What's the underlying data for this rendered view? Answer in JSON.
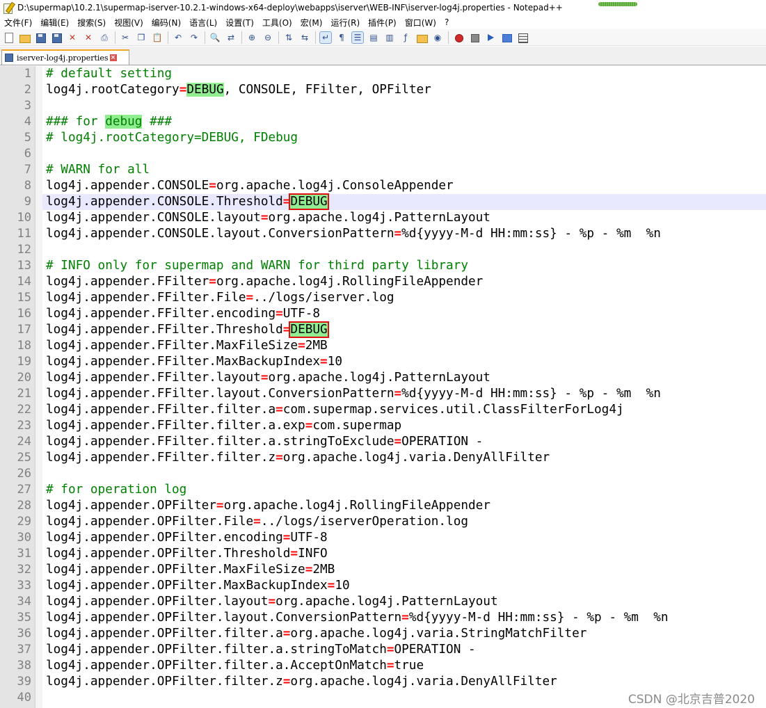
{
  "window": {
    "title": "D:\\supermap\\10.2.1\\supermap-iserver-10.2.1-windows-x64-deploy\\webapps\\iserver\\WEB-INF\\iserver-log4j.properties - Notepad++"
  },
  "menu": [
    "文件(F)",
    "编辑(E)",
    "搜索(S)",
    "视图(V)",
    "编码(N)",
    "语言(L)",
    "设置(T)",
    "工具(O)",
    "宏(M)",
    "运行(R)",
    "插件(P)",
    "窗口(W)",
    "?"
  ],
  "toolbar": [
    {
      "icon": "new-file-icon",
      "type": "doc"
    },
    {
      "icon": "open-file-icon",
      "type": "folder"
    },
    {
      "icon": "save-icon",
      "type": "disk"
    },
    {
      "icon": "save-all-icon",
      "type": "disk"
    },
    {
      "icon": "close-icon",
      "type": "x"
    },
    {
      "icon": "close-all-icon",
      "type": "x"
    },
    {
      "icon": "print-icon",
      "type": "glyph",
      "glyph": "⎙"
    },
    {
      "sep": true
    },
    {
      "icon": "cut-icon",
      "type": "glyph",
      "glyph": "✂"
    },
    {
      "icon": "copy-icon",
      "type": "glyph",
      "glyph": "❐"
    },
    {
      "icon": "paste-icon",
      "type": "glyph",
      "glyph": "📋"
    },
    {
      "sep": true
    },
    {
      "icon": "undo-icon",
      "type": "glyph",
      "glyph": "↶"
    },
    {
      "icon": "redo-icon",
      "type": "glyph",
      "glyph": "↷"
    },
    {
      "sep": true
    },
    {
      "icon": "find-icon",
      "type": "glyph",
      "glyph": "🔍"
    },
    {
      "icon": "replace-icon",
      "type": "glyph",
      "glyph": "⇄"
    },
    {
      "sep": true
    },
    {
      "icon": "zoom-in-icon",
      "type": "glyph",
      "glyph": "⊕"
    },
    {
      "icon": "zoom-out-icon",
      "type": "glyph",
      "glyph": "⊖"
    },
    {
      "sep": true
    },
    {
      "icon": "sync-vertical-icon",
      "type": "glyph",
      "glyph": "⇅"
    },
    {
      "icon": "sync-horizontal-icon",
      "type": "glyph",
      "glyph": "⇆"
    },
    {
      "sep": true
    },
    {
      "icon": "word-wrap-icon",
      "type": "glyph",
      "glyph": "↵",
      "active": true
    },
    {
      "icon": "show-all-chars-icon",
      "type": "glyph",
      "glyph": "¶"
    },
    {
      "icon": "indent-guide-icon",
      "type": "glyph",
      "glyph": "☰",
      "active": true
    },
    {
      "icon": "udl-icon",
      "type": "glyph",
      "glyph": "▤"
    },
    {
      "icon": "doc-map-icon",
      "type": "glyph",
      "glyph": "▥"
    },
    {
      "icon": "function-list-icon",
      "type": "glyph",
      "glyph": "ƒ"
    },
    {
      "icon": "folder-workspace-icon",
      "type": "folder"
    },
    {
      "icon": "monitor-icon",
      "type": "glyph",
      "glyph": "◉"
    },
    {
      "sep": true
    },
    {
      "icon": "record-macro-icon",
      "type": "rec"
    },
    {
      "icon": "stop-macro-icon",
      "type": "stop"
    },
    {
      "icon": "play-macro-icon",
      "type": "play"
    },
    {
      "icon": "run-macro-multiple-icon",
      "type": "ffwd"
    },
    {
      "icon": "save-macro-icon",
      "type": "grid"
    }
  ],
  "tab": {
    "label": "iserver-log4j.properties"
  },
  "editor": {
    "current_line": 9,
    "lines": [
      [
        [
          "c",
          "# default setting"
        ]
      ],
      [
        [
          "k",
          "log4j.rootCategory"
        ],
        [
          "e",
          "="
        ],
        [
          "h",
          "DEBUG"
        ],
        [
          "v",
          ", CONSOLE, FFilter, OPFilter"
        ]
      ],
      [],
      [
        [
          "c",
          "### for "
        ],
        [
          "ch",
          "debug"
        ],
        [
          "c",
          " ###"
        ]
      ],
      [
        [
          "c",
          "# log4j.rootCategory=DEBUG, FDebug"
        ]
      ],
      [],
      [
        [
          "c",
          "# WARN for all"
        ]
      ],
      [
        [
          "k",
          "log4j.appender.CONSOLE"
        ],
        [
          "e",
          "="
        ],
        [
          "v",
          "org.apache.log4j.ConsoleAppender"
        ]
      ],
      [
        [
          "k",
          "log4j.appender.CONSOLE.Threshold"
        ],
        [
          "e",
          "="
        ],
        [
          "hb",
          "DEBUG"
        ]
      ],
      [
        [
          "k",
          "log4j.appender.CONSOLE.layout"
        ],
        [
          "e",
          "="
        ],
        [
          "v",
          "org.apache.log4j.PatternLayout"
        ]
      ],
      [
        [
          "k",
          "log4j.appender.CONSOLE.layout.ConversionPattern"
        ],
        [
          "e",
          "="
        ],
        [
          "v",
          "%d{yyyy-M-d HH:mm:ss} - %p - %m  %n"
        ]
      ],
      [],
      [
        [
          "c",
          "# INFO only for supermap and WARN for third party library"
        ]
      ],
      [
        [
          "k",
          "log4j.appender.FFilter"
        ],
        [
          "e",
          "="
        ],
        [
          "v",
          "org.apache.log4j.RollingFileAppender"
        ]
      ],
      [
        [
          "k",
          "log4j.appender.FFilter.File"
        ],
        [
          "e",
          "="
        ],
        [
          "v",
          "../logs/iserver.log"
        ]
      ],
      [
        [
          "k",
          "log4j.appender.FFilter.encoding"
        ],
        [
          "e",
          "="
        ],
        [
          "v",
          "UTF-8"
        ]
      ],
      [
        [
          "k",
          "log4j.appender.FFilter.Threshold"
        ],
        [
          "e",
          "="
        ],
        [
          "hb",
          "DEBUG"
        ]
      ],
      [
        [
          "k",
          "log4j.appender.FFilter.MaxFileSize"
        ],
        [
          "e",
          "="
        ],
        [
          "v",
          "2MB"
        ]
      ],
      [
        [
          "k",
          "log4j.appender.FFilter.MaxBackupIndex"
        ],
        [
          "e",
          "="
        ],
        [
          "v",
          "10"
        ]
      ],
      [
        [
          "k",
          "log4j.appender.FFilter.layout"
        ],
        [
          "e",
          "="
        ],
        [
          "v",
          "org.apache.log4j.PatternLayout"
        ]
      ],
      [
        [
          "k",
          "log4j.appender.FFilter.layout.ConversionPattern"
        ],
        [
          "e",
          "="
        ],
        [
          "v",
          "%d{yyyy-M-d HH:mm:ss} - %p - %m  %n"
        ]
      ],
      [
        [
          "k",
          "log4j.appender.FFilter.filter.a"
        ],
        [
          "e",
          "="
        ],
        [
          "v",
          "com.supermap.services.util.ClassFilterForLog4j"
        ]
      ],
      [
        [
          "k",
          "log4j.appender.FFilter.filter.a.exp"
        ],
        [
          "e",
          "="
        ],
        [
          "v",
          "com.supermap"
        ]
      ],
      [
        [
          "k",
          "log4j.appender.FFilter.filter.a.stringToExclude"
        ],
        [
          "e",
          "="
        ],
        [
          "v",
          "OPERATION -"
        ]
      ],
      [
        [
          "k",
          "log4j.appender.FFilter.filter.z"
        ],
        [
          "e",
          "="
        ],
        [
          "v",
          "org.apache.log4j.varia.DenyAllFilter"
        ]
      ],
      [],
      [
        [
          "c",
          "# for operation log"
        ]
      ],
      [
        [
          "k",
          "log4j.appender.OPFilter"
        ],
        [
          "e",
          "="
        ],
        [
          "v",
          "org.apache.log4j.RollingFileAppender"
        ]
      ],
      [
        [
          "k",
          "log4j.appender.OPFilter.File"
        ],
        [
          "e",
          "="
        ],
        [
          "v",
          "../logs/iserverOperation.log"
        ]
      ],
      [
        [
          "k",
          "log4j.appender.OPFilter.encoding"
        ],
        [
          "e",
          "="
        ],
        [
          "v",
          "UTF-8"
        ]
      ],
      [
        [
          "k",
          "log4j.appender.OPFilter.Threshold"
        ],
        [
          "e",
          "="
        ],
        [
          "v",
          "INFO"
        ]
      ],
      [
        [
          "k",
          "log4j.appender.OPFilter.MaxFileSize"
        ],
        [
          "e",
          "="
        ],
        [
          "v",
          "2MB"
        ]
      ],
      [
        [
          "k",
          "log4j.appender.OPFilter.MaxBackupIndex"
        ],
        [
          "e",
          "="
        ],
        [
          "v",
          "10"
        ]
      ],
      [
        [
          "k",
          "log4j.appender.OPFilter.layout"
        ],
        [
          "e",
          "="
        ],
        [
          "v",
          "org.apache.log4j.PatternLayout"
        ]
      ],
      [
        [
          "k",
          "log4j.appender.OPFilter.layout.ConversionPattern"
        ],
        [
          "e",
          "="
        ],
        [
          "v",
          "%d{yyyy-M-d HH:mm:ss} - %p - %m  %n"
        ]
      ],
      [
        [
          "k",
          "log4j.appender.OPFilter.filter.a"
        ],
        [
          "e",
          "="
        ],
        [
          "v",
          "org.apache.log4j.varia.StringMatchFilter"
        ]
      ],
      [
        [
          "k",
          "log4j.appender.OPFilter.filter.a.stringToMatch"
        ],
        [
          "e",
          "="
        ],
        [
          "v",
          "OPERATION -"
        ]
      ],
      [
        [
          "k",
          "log4j.appender.OPFilter.filter.a.AcceptOnMatch"
        ],
        [
          "e",
          "="
        ],
        [
          "v",
          "true"
        ]
      ],
      [
        [
          "k",
          "log4j.appender.OPFilter.filter.z"
        ],
        [
          "e",
          "="
        ],
        [
          "v",
          "org.apache.log4j.varia.DenyAllFilter"
        ]
      ],
      []
    ]
  },
  "watermark": "CSDN @北京吉普2020",
  "colors": {
    "comment": "#008000",
    "operator": "#ff0000",
    "highlight": "#90ee90",
    "box": "#e01010",
    "current_line": "#e8e8ff",
    "tab_accent": "#f5a623"
  }
}
